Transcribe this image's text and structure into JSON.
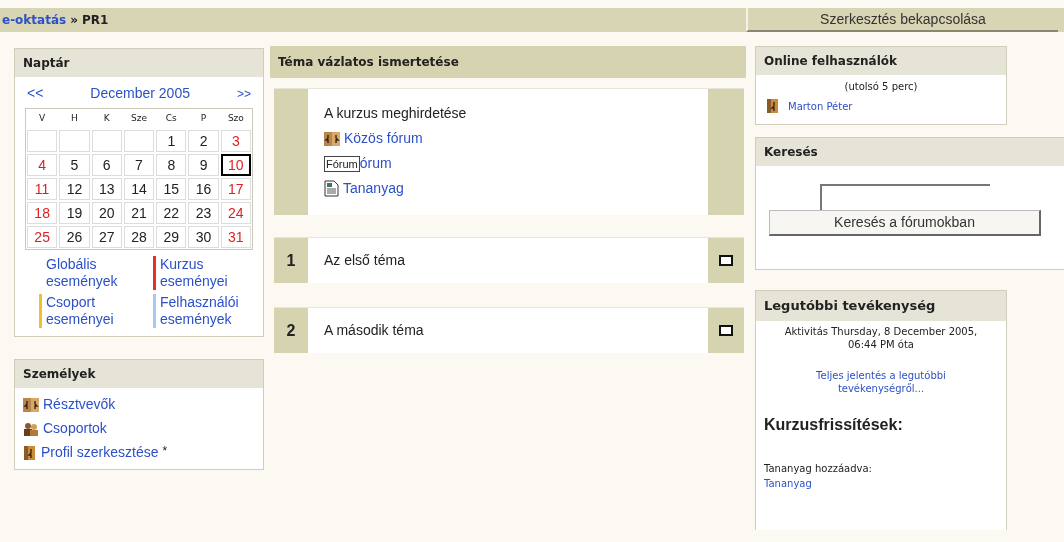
{
  "top_bar": {
    "breadcrumb": [
      {
        "label": "e-oktatás",
        "kind": "link"
      },
      {
        "label": "»",
        "kind": "text"
      },
      {
        "label": "PR1",
        "kind": "text"
      }
    ],
    "edit_button": "Szerkesztés bekapcsolása"
  },
  "calendar": {
    "title": "Naptár",
    "prev": "<<",
    "month": "December 2005",
    "next": ">>",
    "weekdays": [
      "V",
      "H",
      "K",
      "Sze",
      "Cs",
      "P",
      "Szo"
    ],
    "weeks": [
      [
        {
          "kind": "blank"
        },
        {
          "kind": "blank"
        },
        {
          "kind": "blank"
        },
        {
          "kind": "blank"
        },
        {
          "kind": "day",
          "label": "1",
          "weekend": false,
          "today": false
        },
        {
          "kind": "day",
          "label": "2",
          "weekend": false,
          "today": false
        },
        {
          "kind": "day",
          "label": "3",
          "weekend": true,
          "today": false
        }
      ],
      [
        {
          "kind": "day",
          "label": "4",
          "weekend": true,
          "today": false
        },
        {
          "kind": "day",
          "label": "5",
          "weekend": false,
          "today": false
        },
        {
          "kind": "day",
          "label": "6",
          "weekend": false,
          "today": false
        },
        {
          "kind": "day",
          "label": "7",
          "weekend": false,
          "today": false
        },
        {
          "kind": "day",
          "label": "8",
          "weekend": false,
          "today": false
        },
        {
          "kind": "day",
          "label": "9",
          "weekend": false,
          "today": false
        },
        {
          "kind": "day",
          "label": "10",
          "weekend": true,
          "today": true
        }
      ],
      [
        {
          "kind": "day",
          "label": "11",
          "weekend": true,
          "today": false
        },
        {
          "kind": "day",
          "label": "12",
          "weekend": false,
          "today": false
        },
        {
          "kind": "day",
          "label": "13",
          "weekend": false,
          "today": false
        },
        {
          "kind": "day",
          "label": "14",
          "weekend": false,
          "today": false
        },
        {
          "kind": "day",
          "label": "15",
          "weekend": false,
          "today": false
        },
        {
          "kind": "day",
          "label": "16",
          "weekend": false,
          "today": false
        },
        {
          "kind": "day",
          "label": "17",
          "weekend": true,
          "today": false
        }
      ],
      [
        {
          "kind": "day",
          "label": "18",
          "weekend": true,
          "today": false
        },
        {
          "kind": "day",
          "label": "19",
          "weekend": false,
          "today": false
        },
        {
          "kind": "day",
          "label": "20",
          "weekend": false,
          "today": false
        },
        {
          "kind": "day",
          "label": "21",
          "weekend": false,
          "today": false
        },
        {
          "kind": "day",
          "label": "22",
          "weekend": false,
          "today": false
        },
        {
          "kind": "day",
          "label": "23",
          "weekend": false,
          "today": false
        },
        {
          "kind": "day",
          "label": "24",
          "weekend": true,
          "today": false
        }
      ],
      [
        {
          "kind": "day",
          "label": "25",
          "weekend": true,
          "today": false
        },
        {
          "kind": "day",
          "label": "26",
          "weekend": false,
          "today": false
        },
        {
          "kind": "day",
          "label": "27",
          "weekend": false,
          "today": false
        },
        {
          "kind": "day",
          "label": "28",
          "weekend": false,
          "today": false
        },
        {
          "kind": "day",
          "label": "29",
          "weekend": false,
          "today": false
        },
        {
          "kind": "day",
          "label": "30",
          "weekend": false,
          "today": false
        },
        {
          "kind": "day",
          "label": "31",
          "weekend": true,
          "today": false
        }
      ]
    ],
    "legend": [
      {
        "label": "Globális események"
      },
      {
        "label": "Kurzus eseményei",
        "color": "#e03030"
      },
      {
        "label": "Csoport eseményei",
        "color": "#f0c030"
      },
      {
        "label": "Felhasználói események",
        "color": "#a8c8f0"
      }
    ]
  },
  "people": {
    "title": "Személyek",
    "items": [
      {
        "label": "Résztvevők",
        "kind": "participants"
      },
      {
        "label": "Csoportok",
        "kind": "groups"
      },
      {
        "label": "Profil szerkesztése",
        "kind": "profile",
        "suffix": "*"
      }
    ]
  },
  "outline": {
    "title": "Téma vázlatos ismertetése",
    "intro": {
      "summary": "A kurzus meghirdetése",
      "items": [
        {
          "kind": "forum",
          "label": "Közös fórum"
        },
        {
          "kind": "covered",
          "tooltip": "Fórum",
          "label": "órum"
        },
        {
          "kind": "resource",
          "label": "Tananyag"
        }
      ]
    },
    "sections": [
      {
        "number": "1",
        "title": "Az első téma"
      },
      {
        "number": "2",
        "title": "A második téma"
      }
    ]
  },
  "online_users": {
    "title": "Online felhasználók",
    "note": "(utolsó 5 perc)",
    "users": [
      "Marton Péter"
    ]
  },
  "search": {
    "title": "Keresés",
    "button": "Keresés a fórumokban"
  },
  "recent_activity": {
    "title": "Legutóbbi tevékenység",
    "since": "Aktivitás Thursday, 8 December 2005, 06:44 PM óta",
    "report_link": "Teljes jelentés a legutóbbi tevékenységről...",
    "updates_heading": "Kurzusfrissítések:",
    "update_label": "Tananyag hozzáadva:",
    "update_link": "Tananyag"
  }
}
